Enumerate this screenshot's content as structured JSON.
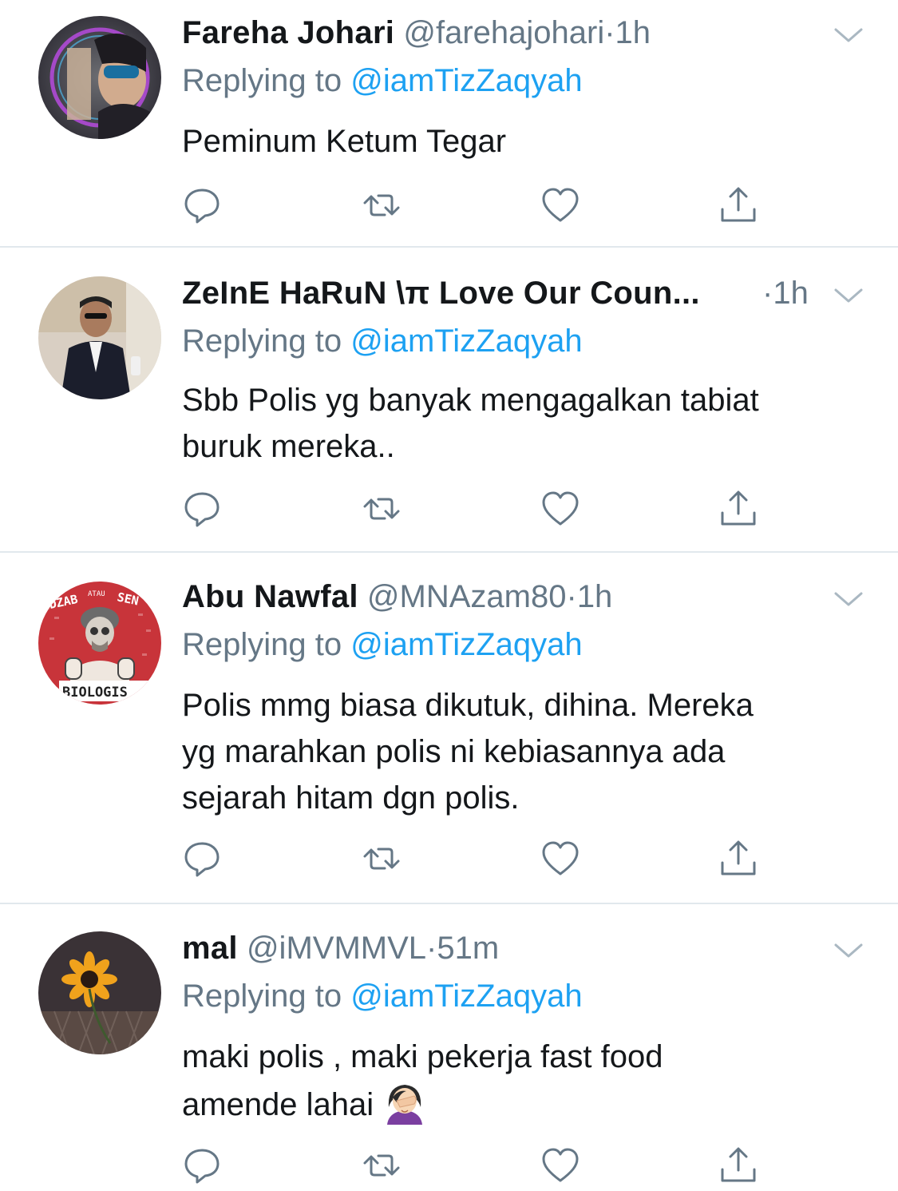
{
  "tweets": [
    {
      "name": "Fareha Johari",
      "handle": "@farehajohari",
      "separator": "·",
      "time": "1h",
      "replying_prefix": "Replying to",
      "replying_to": "@iamTizZaqyah",
      "lines": [
        "Peminum Ketum Tegar"
      ],
      "avatar": "avatar-sunglasses-woman"
    },
    {
      "name": "ZeInE HaRuN \\π Love Our Coun...",
      "handle": "",
      "separator": "·",
      "time": "1h",
      "replying_prefix": "Replying to",
      "replying_to": "@iamTizZaqyah",
      "lines": [
        "Sbb Polis yg banyak mengagalkan tabiat",
        "buruk mereka.."
      ],
      "avatar": "avatar-man-suit"
    },
    {
      "name": "Abu Nawfal",
      "handle": "@MNAzam80",
      "separator": "·",
      "time": "1h",
      "replying_prefix": "Replying to",
      "replying_to": "@iamTizZaqyah",
      "lines": [
        "Polis mmg biasa dikutuk, dihina. Mereka",
        "yg marahkan polis ni kebiasannya ada",
        "sejarah hitam dgn polis."
      ],
      "avatar": "avatar-biologis",
      "avatar_text": [
        "IDZAB",
        "ATAU",
        "SEN",
        "BIOLOGIS"
      ]
    },
    {
      "name": "mal",
      "handle": "@iMVMMVL",
      "separator": "·",
      "time": "51m",
      "replying_prefix": "Replying to",
      "replying_to": "@iamTizZaqyah",
      "lines": [
        "maki polis , maki pekerja fast food",
        "amende lahai"
      ],
      "avatar": "avatar-sunflower",
      "trailing_emoji": "facepalm-woman-emoji"
    }
  ],
  "actions": [
    "reply-icon",
    "retweet-icon",
    "like-icon",
    "share-icon"
  ],
  "colors": {
    "text": "#14171a",
    "secondary": "#657786",
    "link": "#1da1f2",
    "divider": "#e1e8ed",
    "icon": "#657786"
  }
}
